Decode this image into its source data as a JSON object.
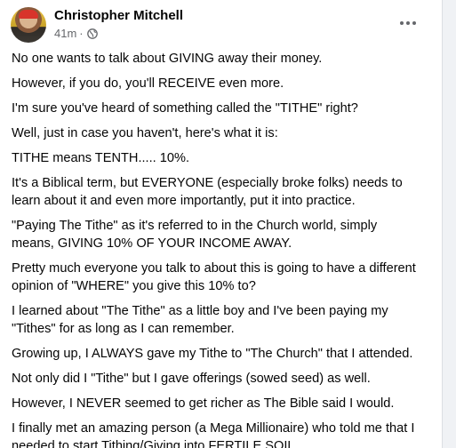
{
  "post": {
    "author": "Christopher Mitchell",
    "time": "41m",
    "separator": "·",
    "audience_icon": "globe-icon",
    "more_icon": "more-options-icon",
    "paragraphs": [
      "No one wants to talk about GIVING away their money.",
      "However, if you do, you'll RECEIVE even more.",
      "I'm sure you've heard of something called the \"TITHE\" right?",
      "Well, just in case you haven't, here's what it is:",
      "TITHE means TENTH..... 10%.",
      "It's a Biblical term, but EVERYONE (especially broke folks) needs to learn about it and even more importantly, put it into practice.",
      "\"Paying The Tithe\" as it's referred to in the Church world, simply means, GIVING 10% OF YOUR INCOME AWAY.",
      "Pretty much everyone you talk to about this is going to have a different opinion of \"WHERE\" you give this 10% to?",
      "I learned about \"The Tithe\" as a little boy and I've been paying my \"Tithes\" for as long as I can remember.",
      "Growing up, I ALWAYS gave my Tithe to \"The Church\" that I attended.",
      "Not only did I \"Tithe\" but I gave offerings (sowed seed) as well.",
      "However, I NEVER seemed to get richer as The Bible said I would.",
      "I finally met an amazing person (a Mega Millionaire) who told me that I needed to start Tithing/Giving into FERTILE SOIL."
    ]
  },
  "colors": {
    "background": "#f0f2f5",
    "card": "#ffffff",
    "text": "#050505",
    "secondary_text": "#65676b"
  }
}
